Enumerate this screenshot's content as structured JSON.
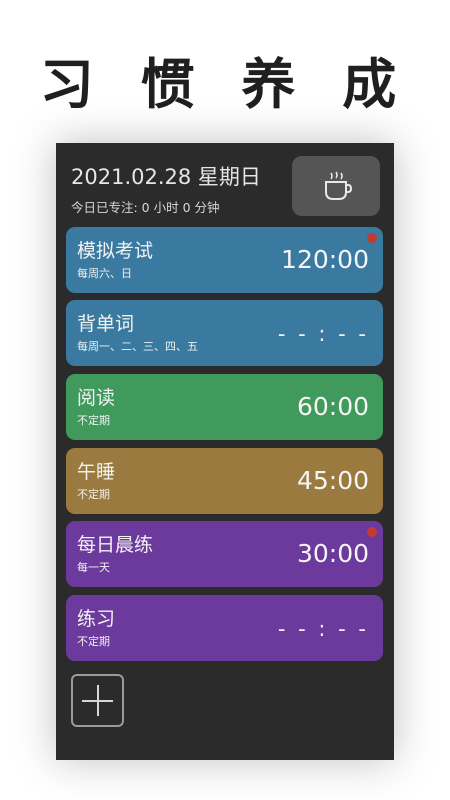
{
  "headline": "习 惯 养 成",
  "header": {
    "date": "2021.02.28 星期日",
    "focus_today": "今日已专注: 0 小时 0 分钟"
  },
  "colors": {
    "blue": "#3a7aa0",
    "green": "#3f9a5b",
    "brown": "#9a7a3e",
    "purple": "#6c3a9c",
    "dot": "#c43a32"
  },
  "habits": [
    {
      "name": "模拟考试",
      "schedule": "每周六、日",
      "time": "120:00",
      "color": "#3a7aa0",
      "reminder": true
    },
    {
      "name": "背单词",
      "schedule": "每周一、二、三、四、五",
      "time": "- - : - -",
      "color": "#3a7aa0",
      "reminder": false
    },
    {
      "name": "阅读",
      "schedule": "不定期",
      "time": "60:00",
      "color": "#3f9a5b",
      "reminder": false
    },
    {
      "name": "午睡",
      "schedule": "不定期",
      "time": "45:00",
      "color": "#9a7a3e",
      "reminder": false
    },
    {
      "name": "每日晨练",
      "schedule": "每一天",
      "time": "30:00",
      "color": "#6c3a9c",
      "reminder": true
    },
    {
      "name": "练习",
      "schedule": "不定期",
      "time": "- - : - -",
      "color": "#6c3a9c",
      "reminder": false
    }
  ],
  "icons": {
    "cup": "coffee-cup-icon",
    "add": "plus-icon"
  }
}
